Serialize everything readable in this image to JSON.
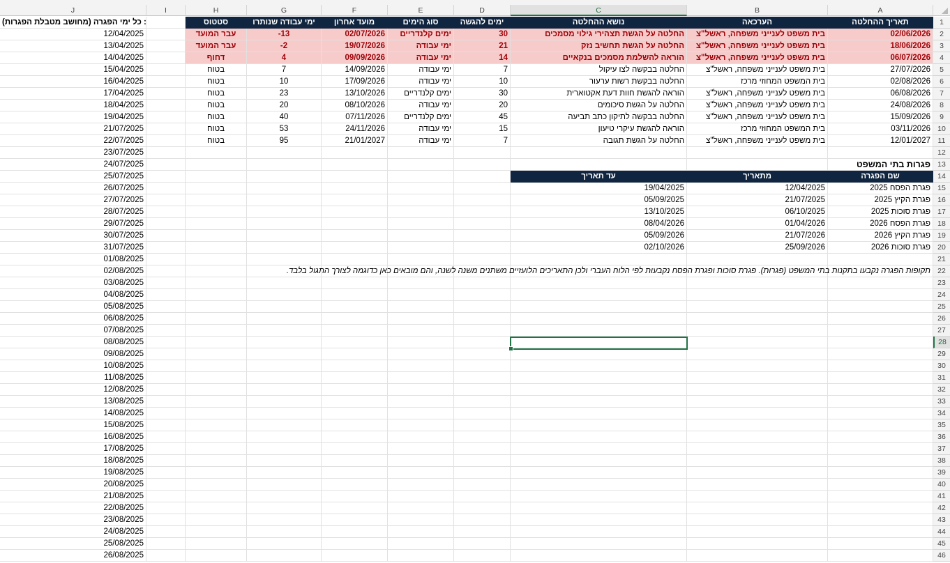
{
  "columns": [
    "J",
    "I",
    "H",
    "G",
    "F",
    "E",
    "D",
    "C",
    "B",
    "A"
  ],
  "selected_column": "C",
  "selected_row": 28,
  "headers": {
    "J": "עד: כל ימי הפגרה (מחושב מטבלת הפגרות)",
    "H": "סטטוס",
    "G": "ימי עבודה שנותרו",
    "F": "מועד אחרון",
    "E": "סוג הימים",
    "D": "ימים להגשה",
    "C": "נושא ההחלטה",
    "B": "הערכאה",
    "A": "תאריך ההחלטה"
  },
  "main_rows": [
    {
      "A": "02/06/2026",
      "B": "בית משפט לענייני משפחה, ראשל\"צ",
      "C": "החלטה על הגשת תצהירי גילוי מסמכים",
      "D": "30",
      "E": "ימים קלנדריים",
      "F": "02/07/2026",
      "G": "-13",
      "H": "עבר המועד",
      "highlight": true
    },
    {
      "A": "18/06/2026",
      "B": "בית משפט לענייני משפחה, ראשל\"צ",
      "C": "החלטה על הגשת תחשיב נזק",
      "D": "21",
      "E": "ימי עבודה",
      "F": "19/07/2026",
      "G": "-2",
      "H": "עבר המועד",
      "highlight": true
    },
    {
      "A": "06/07/2026",
      "B": "בית משפט לענייני משפחה, ראשל\"צ",
      "C": "הוראה להשלמת מסמכים בנקאיים",
      "D": "14",
      "E": "ימי עבודה",
      "F": "09/09/2026",
      "G": "4",
      "H": "דחוף",
      "highlight": true
    },
    {
      "A": "27/07/2026",
      "B": "בית משפט לענייני משפחה, ראשל\"צ",
      "C": "החלטה בבקשה לצו עיקול",
      "D": "7",
      "E": "ימי עבודה",
      "F": "14/09/2026",
      "G": "7",
      "H": "בטוח",
      "highlight": false
    },
    {
      "A": "02/08/2026",
      "B": "בית המשפט המחוזי מרכז",
      "C": "החלטה בבקשת רשות ערעור",
      "D": "10",
      "E": "ימי עבודה",
      "F": "17/09/2026",
      "G": "10",
      "H": "בטוח",
      "highlight": false
    },
    {
      "A": "06/08/2026",
      "B": "בית משפט לענייני משפחה, ראשל\"צ",
      "C": "הוראה להגשת חוות דעת אקטוארית",
      "D": "30",
      "E": "ימים קלנדריים",
      "F": "13/10/2026",
      "G": "23",
      "H": "בטוח",
      "highlight": false
    },
    {
      "A": "24/08/2026",
      "B": "בית משפט לענייני משפחה, ראשל\"צ",
      "C": "החלטה על הגשת סיכומים",
      "D": "20",
      "E": "ימי עבודה",
      "F": "08/10/2026",
      "G": "20",
      "H": "בטוח",
      "highlight": false
    },
    {
      "A": "15/09/2026",
      "B": "בית משפט לענייני משפחה, ראשל\"צ",
      "C": "החלטה בבקשה לתיקון כתב תביעה",
      "D": "45",
      "E": "ימים קלנדריים",
      "F": "07/11/2026",
      "G": "40",
      "H": "בטוח",
      "highlight": false
    },
    {
      "A": "03/11/2026",
      "B": "בית המשפט המחוזי מרכז",
      "C": "הוראה להגשת עיקרי טיעון",
      "D": "15",
      "E": "ימי עבודה",
      "F": "24/11/2026",
      "G": "53",
      "H": "בטוח",
      "highlight": false
    },
    {
      "A": "12/01/2027",
      "B": "בית משפט לענייני משפחה, ראשל\"צ",
      "C": "החלטה על הגשת תגובה",
      "D": "7",
      "E": "ימי עבודה",
      "F": "21/01/2027",
      "G": "95",
      "H": "בטוח",
      "highlight": false
    }
  ],
  "holidays": {
    "title": "פגרות בתי המשפט",
    "headers": {
      "name": "שם הפגרה",
      "from": "מתאריך",
      "to": "עד תאריך"
    },
    "rows": [
      {
        "name": "פגרת הפסח 2025",
        "from": "12/04/2025",
        "to": "19/04/2025"
      },
      {
        "name": "פגרת הקיץ 2025",
        "from": "21/07/2025",
        "to": "05/09/2025"
      },
      {
        "name": "פגרת סוכות 2025",
        "from": "06/10/2025",
        "to": "13/10/2025"
      },
      {
        "name": "פגרת הפסח 2026",
        "from": "01/04/2026",
        "to": "08/04/2026"
      },
      {
        "name": "פגרת הקיץ 2026",
        "from": "21/07/2026",
        "to": "05/09/2026"
      },
      {
        "name": "פגרת סוכות 2026",
        "from": "25/09/2026",
        "to": "02/10/2026"
      }
    ],
    "note": "תקופות הפגרה נקבעו בתקנות בתי המשפט (פגרות). פגרת סוכות ופגרת הפסח נקבעות לפי הלוח העברי ולכן התאריכים הלועזיים משתנים משנה לשנה, והם מובאים כאן כדוגמה לצורך התגול בלבד."
  },
  "holiday_dates": [
    "12/04/2025",
    "13/04/2025",
    "14/04/2025",
    "15/04/2025",
    "16/04/2025",
    "17/04/2025",
    "18/04/2025",
    "19/04/2025",
    "21/07/2025",
    "22/07/2025",
    "23/07/2025",
    "24/07/2025",
    "25/07/2025",
    "26/07/2025",
    "27/07/2025",
    "28/07/2025",
    "29/07/2025",
    "30/07/2025",
    "31/07/2025",
    "01/08/2025",
    "02/08/2025",
    "03/08/2025",
    "04/08/2025",
    "05/08/2025",
    "06/08/2025",
    "07/08/2025",
    "08/08/2025",
    "09/08/2025",
    "10/08/2025",
    "11/08/2025",
    "12/08/2025",
    "13/08/2025",
    "14/08/2025",
    "15/08/2025",
    "16/08/2025",
    "17/08/2025",
    "18/08/2025",
    "19/08/2025",
    "20/08/2025",
    "21/08/2025",
    "22/08/2025",
    "23/08/2025",
    "24/08/2025",
    "25/08/2025",
    "26/08/2025"
  ],
  "row_numbers": [
    1,
    2,
    3,
    4,
    5,
    6,
    7,
    8,
    9,
    10,
    11,
    12,
    13,
    14,
    15,
    16,
    17,
    18,
    19,
    20,
    21,
    22,
    23,
    24,
    25,
    26,
    27,
    28,
    29,
    30,
    31,
    32,
    33,
    34,
    35,
    36,
    37,
    38,
    39,
    40,
    41,
    42,
    43,
    44,
    45,
    46
  ],
  "colors": {
    "header_bg": "#10253f",
    "highlight_bg": "#f8cbcb",
    "highlight_text": "#9c0006",
    "selection": "#217346"
  }
}
